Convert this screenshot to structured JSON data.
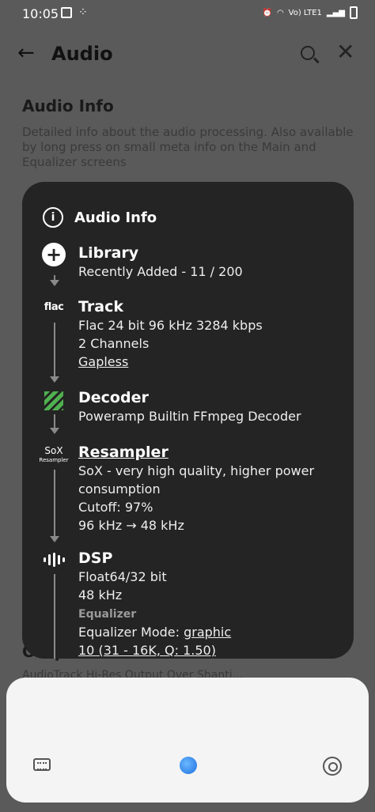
{
  "status_bar": {
    "time": "10:05",
    "network": "Vo) LTE1"
  },
  "app_bar": {
    "title": "Audio"
  },
  "background": {
    "section_title": "Audio Info",
    "section_desc": "Detailed info about the audio processing. Also available by long press on small meta info on the Main and Equalizer screens",
    "output_title": "Output",
    "output_sub": "AudioTrack Hi-Res Output Over Shanti..."
  },
  "dialog": {
    "title": "Audio Info",
    "library": {
      "heading": "Library",
      "lines": [
        "Recently Added - 11 / 200"
      ]
    },
    "track": {
      "icon_text": "flac",
      "heading": "Track",
      "lines": [
        "Flac 24 bit 96 kHz 3284 kbps",
        "2 Channels"
      ],
      "link": "Gapless"
    },
    "decoder": {
      "heading": "Decoder",
      "lines": [
        "Poweramp Builtin FFmpeg Decoder"
      ]
    },
    "resampler": {
      "icon_text": "SoX",
      "icon_sub": "Resampler",
      "heading": "Resampler",
      "lines": [
        "SoX - very high quality, higher power",
        "consumption",
        "Cutoff: 97%",
        "96 kHz → 48 kHz"
      ]
    },
    "dsp": {
      "heading": "DSP",
      "lines": [
        "Float64/32 bit",
        "48 kHz"
      ],
      "eq_label": "Equalizer",
      "eq_mode_prefix": "Equalizer Mode: ",
      "eq_mode_value": "graphic",
      "eq_bands": "10 (31 - 16K, Q: 1.50)"
    }
  }
}
